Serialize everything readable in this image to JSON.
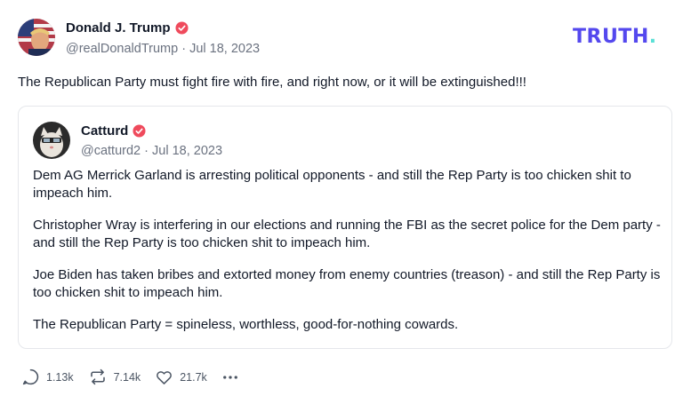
{
  "post": {
    "author": {
      "name": "Donald J. Trump",
      "handle": "@realDonaldTrump",
      "date": "Jul 18, 2023"
    },
    "text": "The Republican Party must fight fire with fire, and right now, or it will be extinguished!!!"
  },
  "brand": {
    "logo_text": "TRUTH",
    "logo_dot": ".",
    "colors": {
      "text": "#5448ee",
      "dot": "#5ae0d6"
    }
  },
  "quote": {
    "author": {
      "name": "Catturd",
      "handle": "@catturd2",
      "date": "Jul 18, 2023"
    },
    "paragraphs": [
      "Dem AG Merrick Garland is arresting political opponents - and still the Rep Party is too chicken shit to impeach him.",
      "Christopher Wray is interfering in our elections and running the FBI as the secret police for the Dem party - and still the Rep Party is too chicken shit to impeach him.",
      "Joe Biden has taken bribes and extorted money from enemy countries (treason) - and still the Rep Party is too chicken shit to impeach him.",
      "The Republican Party = spineless, worthless, good-for-nothing cowards."
    ]
  },
  "actions": {
    "replies": "1.13k",
    "retruths": "7.14k",
    "likes": "21.7k"
  },
  "icons": [
    "verified-badge-icon",
    "reply-icon",
    "retruth-icon",
    "heart-icon",
    "more-icon"
  ],
  "colors": {
    "verified": "#ef4a5c",
    "muted": "#6b7280"
  }
}
